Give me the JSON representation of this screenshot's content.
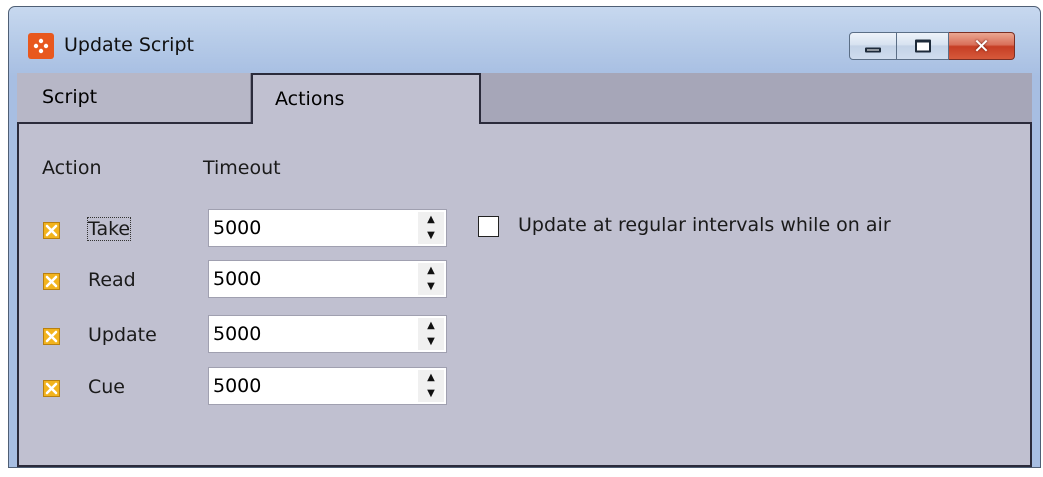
{
  "window": {
    "title": "Update Script",
    "controls": {
      "minimize": "minimize",
      "maximize": "maximize",
      "close": "✕"
    }
  },
  "tabs": [
    {
      "label": "Script",
      "active": false
    },
    {
      "label": "Actions",
      "active": true
    }
  ],
  "panel": {
    "header_action": "Action",
    "header_timeout": "Timeout",
    "rows": [
      {
        "label": "Take",
        "checked": true,
        "timeout": "5000",
        "focused": true
      },
      {
        "label": "Read",
        "checked": true,
        "timeout": "5000",
        "focused": false
      },
      {
        "label": "Update",
        "checked": true,
        "timeout": "5000",
        "focused": false
      },
      {
        "label": "Cue",
        "checked": true,
        "timeout": "5000",
        "focused": false
      }
    ],
    "regular_update": {
      "label": "Update at regular intervals while on air",
      "checked": false
    }
  },
  "colors": {
    "checkbox_fill": "#f2b31d",
    "panel_bg": "#c0c0d0",
    "app_icon": "#e8581e"
  }
}
